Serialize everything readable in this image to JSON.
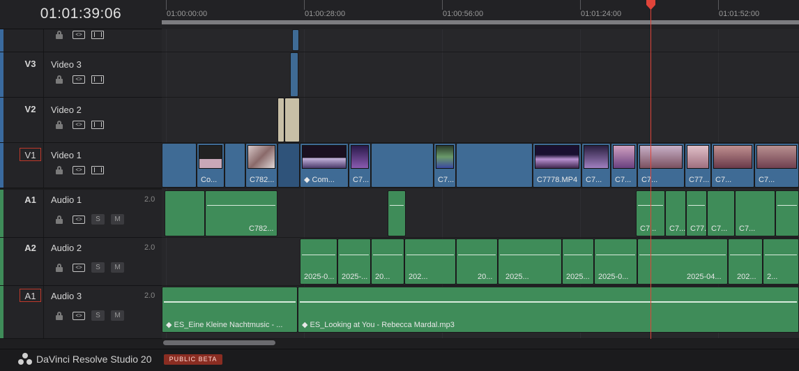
{
  "timecode": "01:01:39:06",
  "ruler": {
    "labels": [
      "01:00:00:00",
      "01:00:28:00",
      "01:00:56:00",
      "01:01:24:00",
      "01:01:52:00"
    ]
  },
  "tracks": {
    "v4": {
      "id": "",
      "name": ""
    },
    "v3": {
      "id": "V3",
      "name": "Video 3"
    },
    "v2": {
      "id": "V2",
      "name": "Video 2"
    },
    "v1": {
      "id": "V1",
      "name": "Video 1"
    },
    "a1": {
      "id": "A1",
      "name": "Audio 1",
      "channels": "2.0",
      "solo": "S",
      "mute": "M"
    },
    "a2": {
      "id": "A2",
      "name": "Audio 2",
      "channels": "2.0",
      "solo": "S",
      "mute": "M"
    },
    "a3": {
      "id": "A1",
      "name": "Audio 3",
      "channels": "2.0",
      "solo": "S",
      "mute": "M"
    }
  },
  "clips": {
    "video1": [
      "Co...",
      "C782...",
      "Com...",
      "C7...",
      "C7...",
      "C7778.MP4",
      "C7...",
      "C7...",
      "C7...",
      "C77...",
      "C7...",
      "C7..."
    ],
    "audio1": [
      "C782...",
      "C7...",
      "C7...",
      "C77...",
      "C7...",
      "C7..."
    ],
    "audio2": [
      "2025-0...",
      "2025-...",
      "20...",
      "202...",
      "20...",
      "2025...",
      "2025...",
      "2025-0...",
      "2025-04...",
      "202...",
      "2..."
    ],
    "audio3": [
      "ES_Eine Kleine Nachtmusic - ...",
      "ES_Looking at You - Rebecca Mardal.mp3"
    ]
  },
  "footer": {
    "app_name": "DaVinci Resolve Studio 20",
    "badge": "PUBLIC BETA"
  },
  "colors": {
    "video_clip": "#3f6b95",
    "audio_clip": "#3f8c59",
    "playhead": "#e0443a",
    "beta_badge": "#8a2d22"
  }
}
